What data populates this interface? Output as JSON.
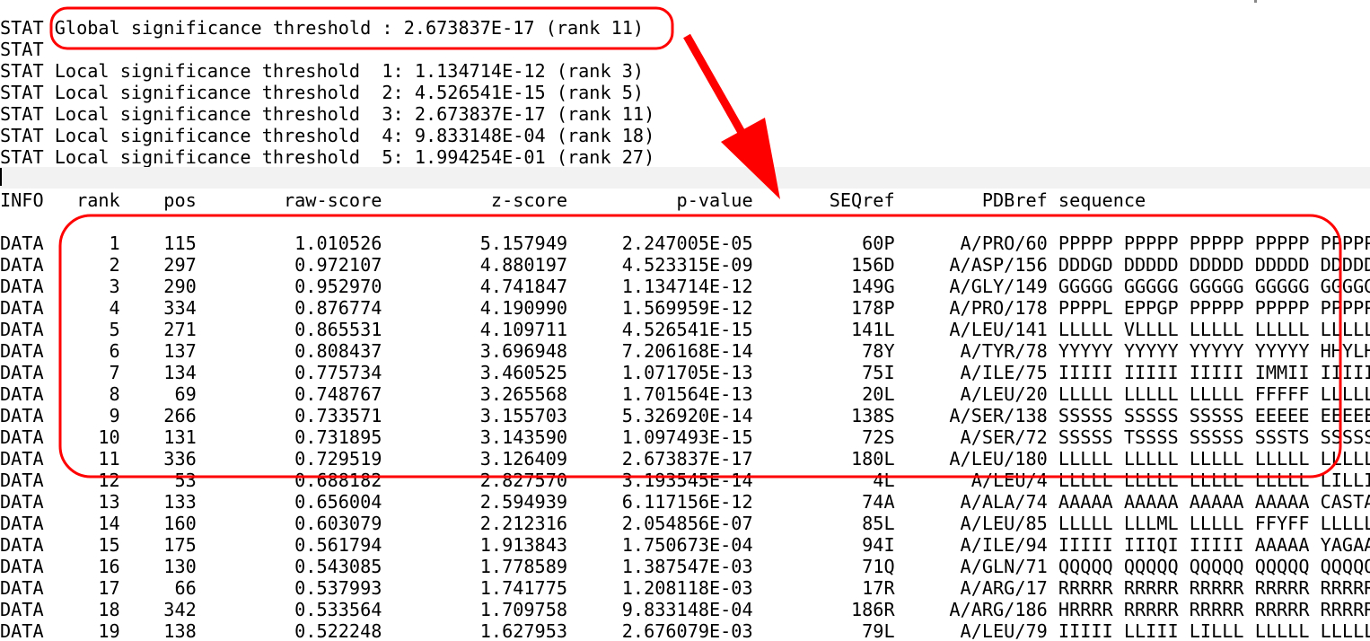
{
  "stat_lines": [
    "STAT Global significance threshold : 2.673837E-17 (rank 11)",
    "STAT",
    "STAT Local significance threshold  1: 1.134714E-12 (rank 3)",
    "STAT Local significance threshold  2: 4.526541E-15 (rank 5)",
    "STAT Local significance threshold  3: 2.673837E-17 (rank 11)",
    "STAT Local significance threshold  4: 9.833148E-04 (rank 18)",
    "STAT Local significance threshold  5: 1.994254E-01 (rank 27)"
  ],
  "header_line": "INFO   rank    pos        raw-score          z-score          p-value       SEQref        PDBref sequence",
  "data_lines": [
    "DATA      1    115         1.010526         5.157949     2.247005E-05          60P      A/PRO/60 PPPPP PPPPP PPPPP PPPPP PPPPP",
    "DATA      2    297         0.972107         4.880197     4.523315E-09         156D     A/ASP/156 DDDGD DDDDD DDDDD DDDDD DDDDD",
    "DATA      3    290         0.952970         4.741847     1.134714E-12         149G     A/GLY/149 GGGGG GGGGG GGGGG GGGGG GGGGG",
    "DATA      4    334         0.876774         4.190990     1.569959E-12         178P     A/PRO/178 PPPPL EPPGP PPPPP PPPPP PPPPP",
    "DATA      5    271         0.865531         4.109711     4.526541E-15         141L     A/LEU/141 LLLLL VLLLL LLLLL LLLLL LLLLL",
    "DATA      6    137         0.808437         3.696948     7.206168E-14          78Y      A/TYR/78 YYYYY YYYYY YYYYY YYYYY HHYLH",
    "DATA      7    134         0.775734         3.460525     1.071705E-13          75I      A/ILE/75 IIIII IIIII IIIII IMMII IIIII",
    "DATA      8     69         0.748767         3.265568     1.701564E-13          20L      A/LEU/20 LLLLL LLLLL LLLLL FFFFF LLLLL",
    "DATA      9    266         0.733571         3.155703     5.326920E-14         138S     A/SER/138 SSSSS SSSSS SSSSS EEEEE EEEEE",
    "DATA     10    131         0.731895         3.143590     1.097493E-15          72S      A/SER/72 SSSSS TSSSS SSSSS SSSTS SSSSS",
    "DATA     11    336         0.729519         3.126409     2.673837E-17         180L     A/LEU/180 LLLLL LLLLL LLLLL LLLLL LLLLL",
    "DATA     12     53         0.688182         2.827570     3.193545E-14           4L       A/LEU/4 LLLLL LLLLL LLLLL LLLLL LILLI",
    "DATA     13    133         0.656004         2.594939     6.117156E-12          74A      A/ALA/74 AAAAA AAAAA AAAAA AAAAA CASTA",
    "DATA     14    160         0.603079         2.212316     2.054856E-07          85L      A/LEU/85 LLLLL LLLML LLLLL FFYFF LLLLL",
    "DATA     15    175         0.561794         1.913843     1.750673E-04          94I      A/ILE/94 IIIII IIIQI IIIII AAAAA YAGAA",
    "DATA     16    130         0.543085         1.778589     1.387547E-03          71Q      A/GLN/71 QQQQQ QQQQQ QQQQQ QQQQQ QQQQQ",
    "DATA     17     66         0.537993         1.741775     1.208118E-03          17R      A/ARG/17 RRRRR RRRRR RRRRR RRRRR RRRRR",
    "DATA     18    342         0.533564         1.709758     9.833148E-04         186R     A/ARG/186 HRRRR RRRRR RRRRR RRRRR RRRRR",
    "DATA     19    138         0.522248         1.627953     2.676079E-03          79L      A/LEU/79 IIIII LLIII LILLL LLLLL LLLLL"
  ],
  "annotation_color": "#ff0000"
}
